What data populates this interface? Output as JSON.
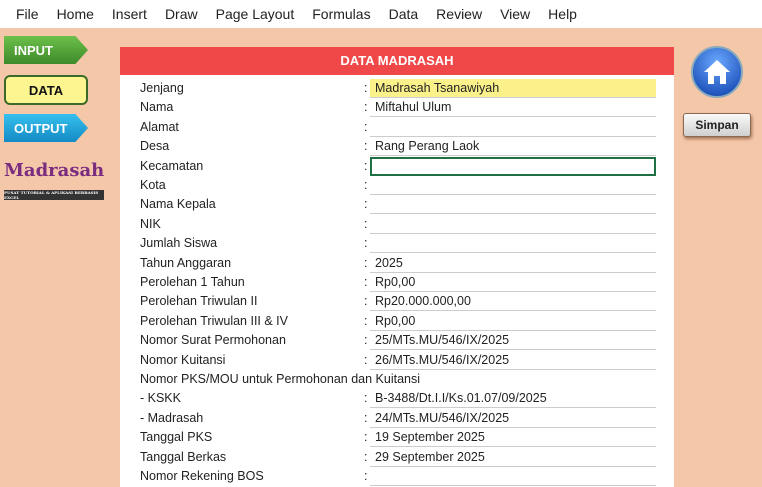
{
  "menu": [
    "File",
    "Home",
    "Insert",
    "Draw",
    "Page Layout",
    "Formulas",
    "Data",
    "Review",
    "View",
    "Help"
  ],
  "nav": {
    "input": "INPUT",
    "data": "DATA",
    "output": "OUTPUT"
  },
  "logo": {
    "text": "Madrasah",
    "sub": "PUSAT TUTORIAL & APLIKASI BERBASIS EXCEL"
  },
  "buttons": {
    "home_icon": "home-icon",
    "simpan": "Simpan"
  },
  "form": {
    "title": "DATA MADRASAH",
    "rows": [
      {
        "label": "Jenjang",
        "value": "Madrasah Tsanawiyah"
      },
      {
        "label": "Nama",
        "value": "Miftahul Ulum"
      },
      {
        "label": "Alamat",
        "value": ""
      },
      {
        "label": "Desa",
        "value": "Rang Perang Laok"
      },
      {
        "label": "Kecamatan",
        "value": ""
      },
      {
        "label": "Kota",
        "value": ""
      },
      {
        "label": "Nama Kepala",
        "value": ""
      },
      {
        "label": "NIK",
        "value": ""
      },
      {
        "label": "Jumlah Siswa",
        "value": ""
      },
      {
        "label": "Tahun Anggaran",
        "value": "2025"
      },
      {
        "label": "Perolehan 1 Tahun",
        "value": "Rp0,00"
      },
      {
        "label": "Perolehan Triwulan II",
        "value": "Rp20.000.000,00"
      },
      {
        "label": "Perolehan Triwulan III & IV",
        "value": "Rp0,00"
      },
      {
        "label": "Nomor Surat Permohonan",
        "value": "25/MTs.MU/546/IX/2025"
      },
      {
        "label": "Nomor Kuitansi",
        "value": "26/MTs.MU/546/IX/2025"
      },
      {
        "label": "Nomor PKS/MOU untuk Permohonan dan Kuitansi",
        "heading": true
      },
      {
        "label": "- KSKK",
        "value": "B-3488/Dt.I.I/Ks.01.07/09/2025"
      },
      {
        "label": "- Madrasah",
        "value": "24/MTs.MU/546/IX/2025"
      },
      {
        "label": "Tanggal PKS",
        "value": "19 September 2025"
      },
      {
        "label": "Tanggal Berkas",
        "value": "29 September 2025"
      },
      {
        "label": "Nomor Rekening BOS",
        "value": ""
      }
    ]
  }
}
